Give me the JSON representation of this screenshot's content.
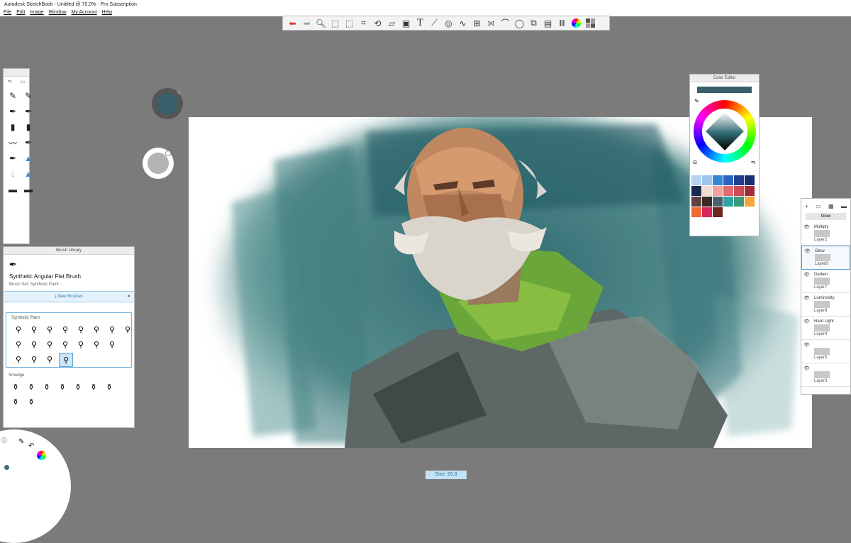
{
  "window": {
    "title": "Autodesk SketchBook - Untitled @ 70,0% - Pro Subscription"
  },
  "menu": [
    "File",
    "Edit",
    "Image",
    "Window",
    "My Account",
    "Help"
  ],
  "toolbar": {
    "tools": [
      "undo-icon",
      "redo-icon",
      "zoom-icon",
      "select-icon",
      "crop-select-icon",
      "crop-icon",
      "transform-icon",
      "distort-icon",
      "fill-icon",
      "text-icon",
      "ruler-icon",
      "ellipse-guide-icon",
      "french-curve-icon",
      "perspective-icon",
      "symmetry-icon",
      "stroke-icon",
      "lasso-icon",
      "copy-icon",
      "layer-icon",
      "brush-library-icon",
      "color-wheel-icon",
      "copic-icon"
    ]
  },
  "colors": {
    "accent": "#3a6e79",
    "current_color": "#37606a"
  },
  "brush_library": {
    "title": "Brush Library",
    "selected_brush": "Synthetic Angular Flat Brush",
    "brush_set": "Brush Set: Synthetic Paint",
    "new_brushes": "New Brushes",
    "sections": [
      "Synthetic Paint",
      "Smudge"
    ]
  },
  "color_editor": {
    "title": "Color Editor",
    "swatches": [
      "#b7d1f0",
      "#9ec3ee",
      "#3486d6",
      "#2a63c2",
      "#1e3f8e",
      "#182f70",
      "#172a52",
      "#f4ddd0",
      "#f3a39c",
      "#e16b6e",
      "#cc4a52",
      "#a32c3a",
      "#5b4343",
      "#3a2a28",
      "#4a6270",
      "#2fa3a3",
      "#3f9a7c",
      "#f3a53a",
      "#ef6a37",
      "#d8285b",
      "#6a2820"
    ]
  },
  "layers": {
    "glow_label": "Glow",
    "items": [
      {
        "mode": "Multiply",
        "name": "Layer2"
      },
      {
        "mode": "Glow",
        "name": "Layer8"
      },
      {
        "mode": "Darken",
        "name": "Layer7"
      },
      {
        "mode": "Luminosity",
        "name": "Layer9"
      },
      {
        "mode": "Hard Light",
        "name": "Layer4"
      },
      {
        "mode": "",
        "name": "Layer5"
      },
      {
        "mode": "",
        "name": "Layer3"
      }
    ]
  },
  "status": {
    "size": "Size: 20.3"
  }
}
